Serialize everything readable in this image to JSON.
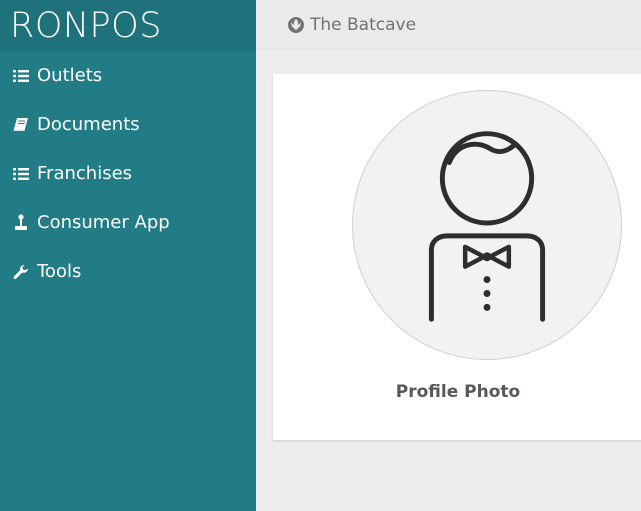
{
  "sidebar": {
    "brand": "RONPOS",
    "items": [
      {
        "label": "Outlets",
        "icon": "list-icon"
      },
      {
        "label": "Documents",
        "icon": "book-icon"
      },
      {
        "label": "Franchises",
        "icon": "list-icon"
      },
      {
        "label": "Consumer App",
        "icon": "joystick-icon"
      },
      {
        "label": "Tools",
        "icon": "wrench-icon"
      }
    ]
  },
  "topbar": {
    "title": "The Batcave",
    "icon": "rebel-alliance-icon"
  },
  "profile": {
    "label": "Profile Photo",
    "icon": "person-bowtie-avatar-icon"
  },
  "colors": {
    "sidebar": "#217c86",
    "brand_bar": "#1f727b",
    "background": "#ebecec"
  }
}
